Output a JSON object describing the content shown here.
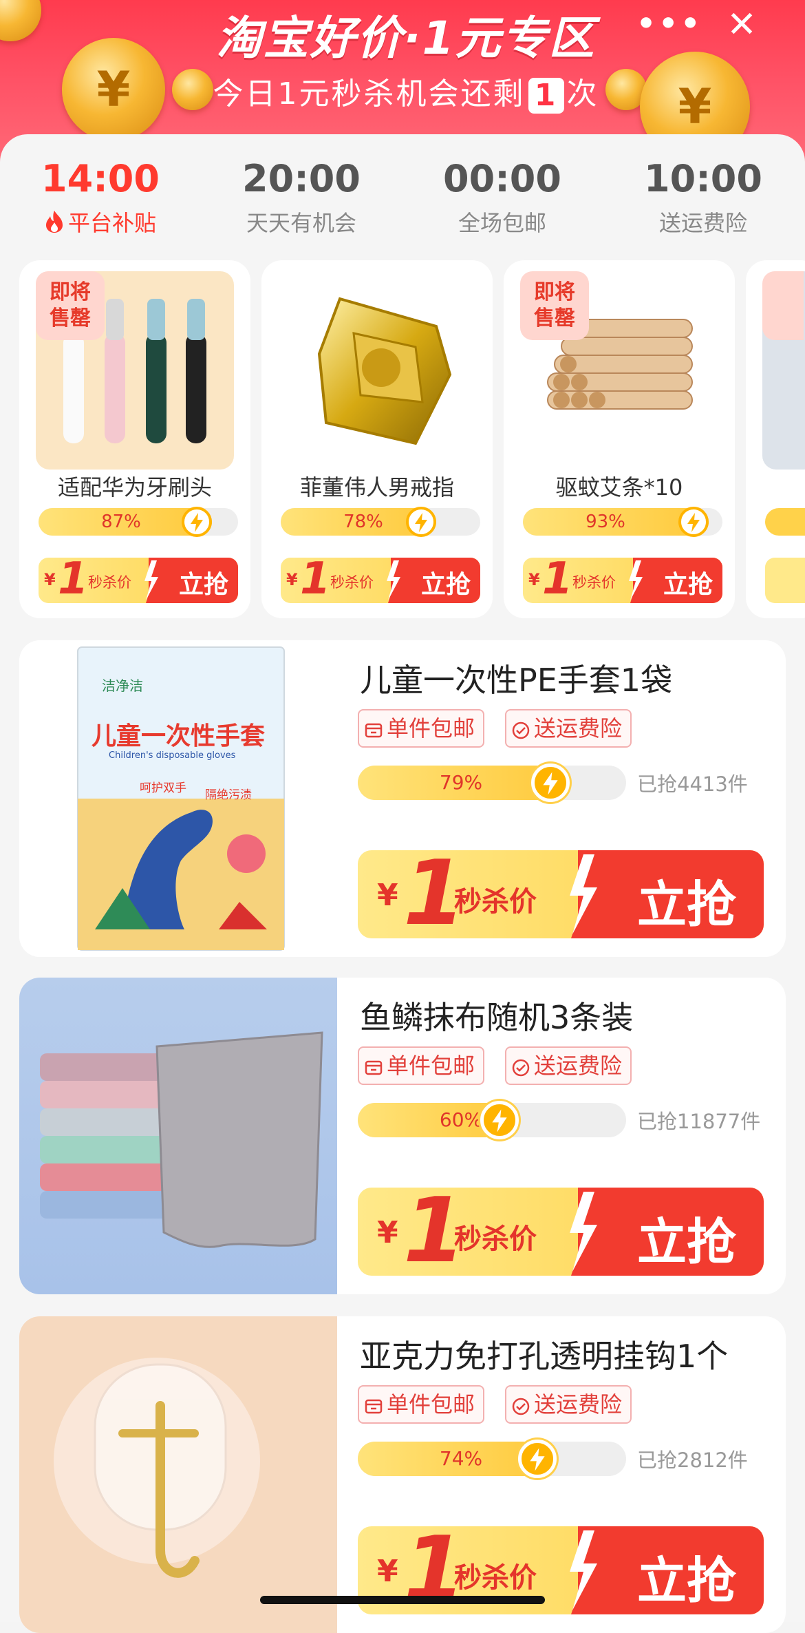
{
  "header": {
    "title": "淘宝好价·1元专区",
    "sub_prefix": "今日1元秒杀机会还剩",
    "remaining": "1",
    "sub_suffix": "次",
    "more_label": "•••",
    "close_label": "✕"
  },
  "colors": {
    "accent": "#ff3a2e",
    "header_red": "#ff3b4e",
    "progress_yellow": "#ffc93a",
    "buy_red": "#f23b2f"
  },
  "tabs": [
    {
      "time": "14:00",
      "desc": "平台补贴",
      "active": true
    },
    {
      "time": "20:00",
      "desc": "天天有机会",
      "active": false
    },
    {
      "time": "00:00",
      "desc": "全场包邮",
      "active": false
    },
    {
      "time": "10:00",
      "desc": "送运费险",
      "active": false
    }
  ],
  "mini_products": [
    {
      "name": "适配华为牙刷头",
      "percent": "87%",
      "progress": 0.87,
      "badge": "即将\n售罄",
      "price_yen": "¥",
      "price": "1",
      "tag": "秒杀价",
      "cta": "立抢"
    },
    {
      "name": "菲董伟人男戒指",
      "percent": "78%",
      "progress": 0.78,
      "badge": "",
      "price_yen": "¥",
      "price": "1",
      "tag": "秒杀价",
      "cta": "立抢"
    },
    {
      "name": "驱蚊艾条*10",
      "percent": "93%",
      "progress": 0.93,
      "badge": "即将\n售罄",
      "price_yen": "¥",
      "price": "1",
      "tag": "秒杀价",
      "cta": "立抢"
    }
  ],
  "products": [
    {
      "title": "儿童一次性PE手套1袋",
      "chip1": "单件包邮",
      "chip2": "送运费险",
      "percent": "79%",
      "progress": 0.79,
      "sold": "已抢4413件",
      "price_yen": "¥",
      "price": "1",
      "tag": "秒杀价",
      "cta": "立抢",
      "package_title": "儿童一次性手套",
      "package_sub": "Children's disposable gloves",
      "package_brand": "洁净洁",
      "package_note1": "呵护双手",
      "package_note2": "隔绝污渍"
    },
    {
      "title": "鱼鳞抹布随机3条装",
      "chip1": "单件包邮",
      "chip2": "送运费险",
      "percent": "60%",
      "progress": 0.6,
      "sold": "已抢11877件",
      "price_yen": "¥",
      "price": "1",
      "tag": "秒杀价",
      "cta": "立抢"
    },
    {
      "title": "亚克力免打孔透明挂钩1个",
      "chip1": "单件包邮",
      "chip2": "送运费险",
      "percent": "74%",
      "progress": 0.74,
      "sold": "已抢2812件",
      "price_yen": "¥",
      "price": "1",
      "tag": "秒杀价",
      "cta": "立抢"
    }
  ]
}
